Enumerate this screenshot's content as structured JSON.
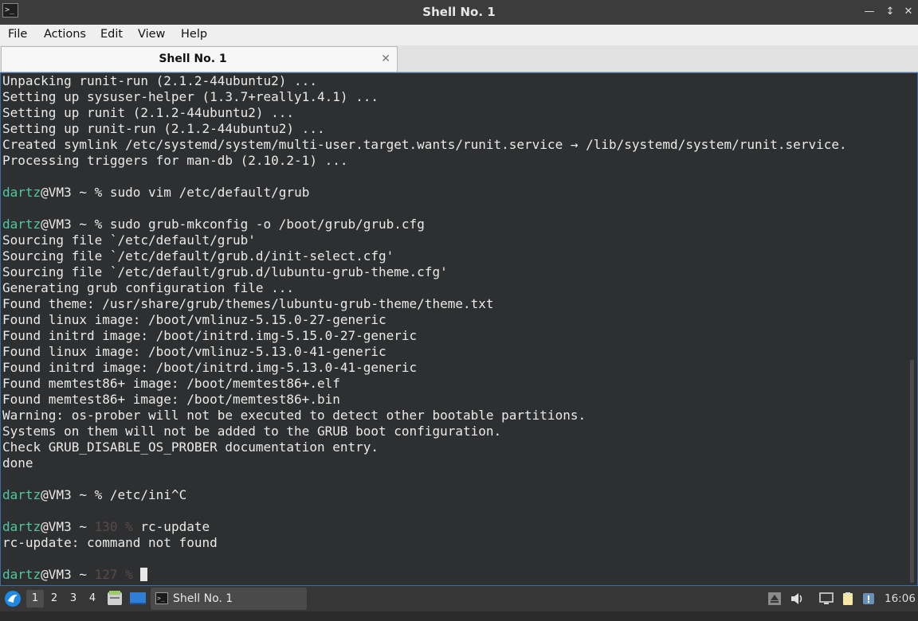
{
  "window": {
    "title": "Shell No. 1",
    "app_icon_glyph": ">_",
    "min_glyph": "—",
    "max_glyph": "↕",
    "close_glyph": "✕"
  },
  "menu": {
    "file": "File",
    "actions": "Actions",
    "edit": "Edit",
    "view": "View",
    "help": "Help"
  },
  "tabs": [
    {
      "label": "Shell No. 1",
      "close_glyph": "✕"
    }
  ],
  "terminal": {
    "lines": [
      {
        "text": "Unpacking runit-run (2.1.2-44ubuntu2) ..."
      },
      {
        "text": "Setting up sysuser-helper (1.3.7+really1.4.1) ..."
      },
      {
        "text": "Setting up runit (2.1.2-44ubuntu2) ..."
      },
      {
        "text": "Setting up runit-run (2.1.2-44ubuntu2) ..."
      },
      {
        "text": "Created symlink /etc/systemd/system/multi-user.target.wants/runit.service → /lib/systemd/system/runit.service."
      },
      {
        "text": "Processing triggers for man-db (2.10.2-1) ..."
      },
      {
        "text": ""
      },
      {
        "user": "dartz",
        "host": "@VM3 ~ ",
        "status": "",
        "prompt": "% ",
        "cmd": "sudo vim /etc/default/grub"
      },
      {
        "text": ""
      },
      {
        "user": "dartz",
        "host": "@VM3 ~ ",
        "status": "",
        "prompt": "% ",
        "cmd": "sudo grub-mkconfig -o /boot/grub/grub.cfg"
      },
      {
        "text": "Sourcing file `/etc/default/grub'"
      },
      {
        "text": "Sourcing file `/etc/default/grub.d/init-select.cfg'"
      },
      {
        "text": "Sourcing file `/etc/default/grub.d/lubuntu-grub-theme.cfg'"
      },
      {
        "text": "Generating grub configuration file ..."
      },
      {
        "text": "Found theme: /usr/share/grub/themes/lubuntu-grub-theme/theme.txt"
      },
      {
        "text": "Found linux image: /boot/vmlinuz-5.15.0-27-generic"
      },
      {
        "text": "Found initrd image: /boot/initrd.img-5.15.0-27-generic"
      },
      {
        "text": "Found linux image: /boot/vmlinuz-5.13.0-41-generic"
      },
      {
        "text": "Found initrd image: /boot/initrd.img-5.13.0-41-generic"
      },
      {
        "text": "Found memtest86+ image: /boot/memtest86+.elf"
      },
      {
        "text": "Found memtest86+ image: /boot/memtest86+.bin"
      },
      {
        "text": "Warning: os-prober will not be executed to detect other bootable partitions."
      },
      {
        "text": "Systems on them will not be added to the GRUB boot configuration."
      },
      {
        "text": "Check GRUB_DISABLE_OS_PROBER documentation entry."
      },
      {
        "text": "done"
      },
      {
        "text": ""
      },
      {
        "user": "dartz",
        "host": "@VM3 ~ ",
        "status": "",
        "prompt": "% ",
        "cmd": "/etc/ini^C"
      },
      {
        "text": ""
      },
      {
        "user": "dartz",
        "host": "@VM3 ~ ",
        "status": "130 ",
        "prompt": "% ",
        "cmd": "rc-update"
      },
      {
        "text": "rc-update: command not found"
      },
      {
        "text": ""
      },
      {
        "user": "dartz",
        "host": "@VM3 ~ ",
        "status": "127 ",
        "prompt": "% ",
        "cmd": "",
        "cursor": true
      }
    ]
  },
  "taskbar": {
    "desktops": [
      "1",
      "2",
      "3",
      "4"
    ],
    "active_desktop": "1",
    "task_label": "Shell No. 1",
    "clock": "16:06"
  }
}
